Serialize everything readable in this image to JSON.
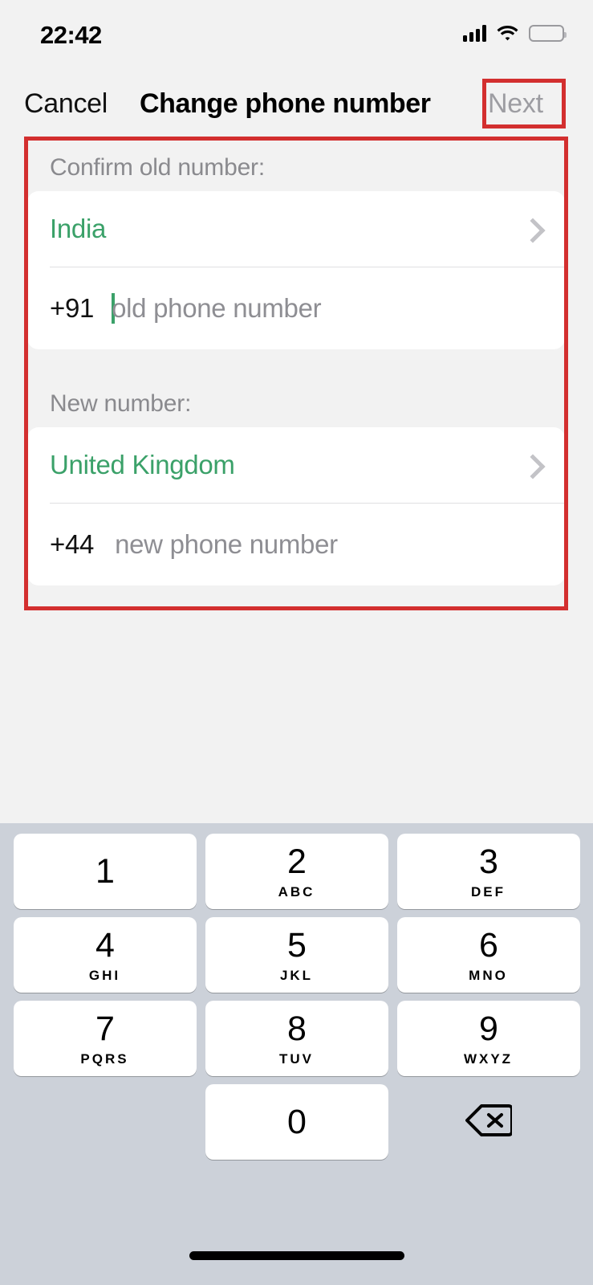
{
  "status_bar": {
    "time": "22:42",
    "signal_icon": "cellular-signal-icon",
    "wifi_icon": "wifi-icon",
    "battery_icon": "battery-icon",
    "battery_color": "#f5c518",
    "battery_level_percent": 25
  },
  "nav_bar": {
    "cancel_label": "Cancel",
    "title": "Change phone number",
    "next_label": "Next",
    "next_disabled": true,
    "next_color": "#9d9da2"
  },
  "accent_color": "#3ba169",
  "annotation_color": "#d32f2f",
  "form": {
    "old_section": {
      "label": "Confirm old number:",
      "country": "India",
      "dial_code": "+91",
      "input_value": "",
      "placeholder": "old phone number",
      "focused": true,
      "chevron_icon": "chevron-right-icon"
    },
    "new_section": {
      "label": "New number:",
      "country": "United Kingdom",
      "dial_code": "+44",
      "input_value": "",
      "placeholder": "new phone number",
      "focused": false,
      "chevron_icon": "chevron-right-icon"
    }
  },
  "keyboard": {
    "type": "numeric-phone-pad",
    "rows": [
      [
        {
          "num": "1",
          "sub": ""
        },
        {
          "num": "2",
          "sub": "ABC"
        },
        {
          "num": "3",
          "sub": "DEF"
        }
      ],
      [
        {
          "num": "4",
          "sub": "GHI"
        },
        {
          "num": "5",
          "sub": "JKL"
        },
        {
          "num": "6",
          "sub": "MNO"
        }
      ],
      [
        {
          "num": "7",
          "sub": "PQRS"
        },
        {
          "num": "8",
          "sub": "TUV"
        },
        {
          "num": "9",
          "sub": "WXYZ"
        }
      ]
    ],
    "zero_key": {
      "num": "0",
      "sub": ""
    },
    "delete_icon": "backspace-delete-icon"
  },
  "home_indicator": "home-indicator-bar"
}
